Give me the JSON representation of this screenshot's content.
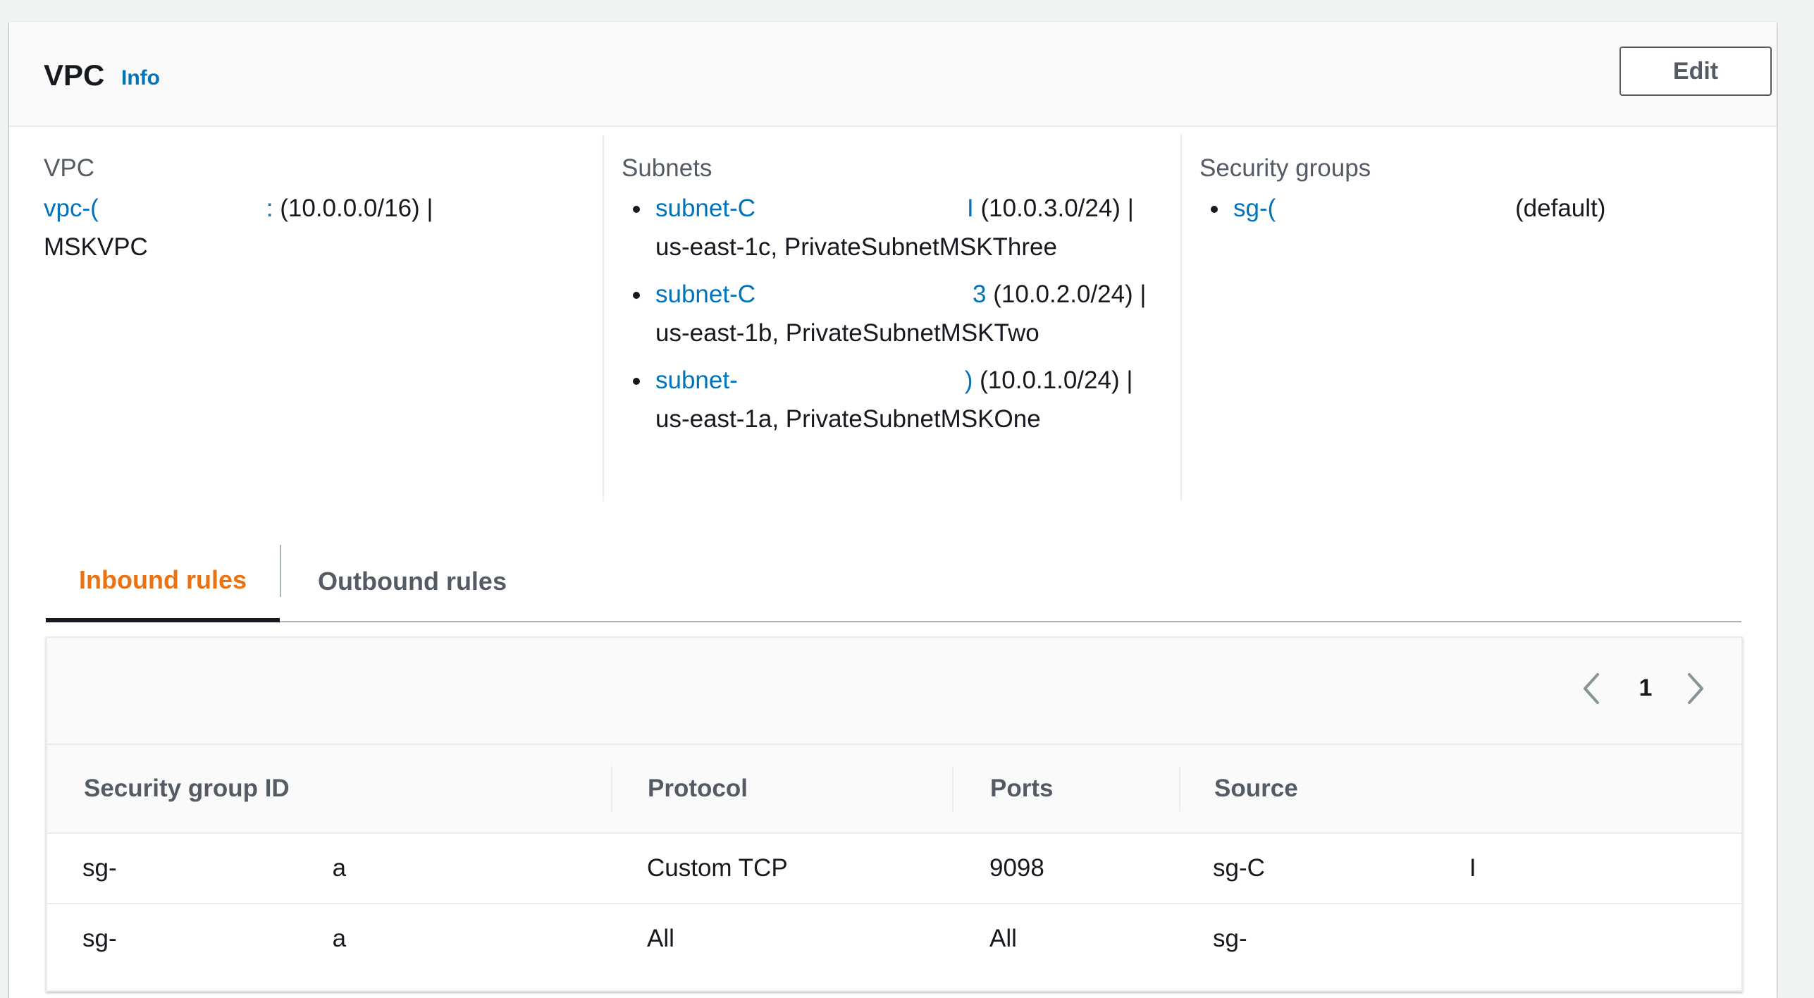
{
  "header": {
    "title": "VPC",
    "info_label": "Info",
    "edit_label": "Edit"
  },
  "vpc": {
    "label": "VPC",
    "id_link": "vpc-(",
    "id_tail": ": ",
    "cidr": "(10.0.0.0/16) |",
    "name": "MSKVPC"
  },
  "subnets": {
    "label": "Subnets",
    "items": [
      {
        "id": "subnet-C",
        "tail": "I",
        "cidr": "(10.0.3.0/24) |",
        "detail": "us-east-1c, PrivateSubnetMSKThree"
      },
      {
        "id": "subnet-C",
        "tail": "3",
        "cidr": "(10.0.2.0/24) |",
        "detail": "us-east-1b, PrivateSubnetMSKTwo"
      },
      {
        "id": "subnet-",
        "tail": ")",
        "cidr": "(10.0.1.0/24) |",
        "detail": "us-east-1a, PrivateSubnetMSKOne"
      }
    ]
  },
  "security_groups": {
    "label": "Security groups",
    "items": [
      {
        "id": "sg-(",
        "suffix": "(default)"
      }
    ]
  },
  "tabs": {
    "inbound": "Inbound rules",
    "outbound": "Outbound rules",
    "active": "inbound"
  },
  "pagination": {
    "page": "1",
    "prev_icon": "chevron-left-icon",
    "next_icon": "chevron-right-icon"
  },
  "table": {
    "columns": [
      "Security group ID",
      "Protocol",
      "Ports",
      "Source"
    ],
    "rows": [
      {
        "sg_id": "sg-",
        "sg_tail": "a",
        "protocol": "Custom TCP",
        "ports": "9098",
        "source": "sg-C",
        "source_tail": "I"
      },
      {
        "sg_id": "sg-",
        "sg_tail": "a",
        "protocol": "All",
        "ports": "All",
        "source": "sg-",
        "source_tail": ""
      }
    ]
  },
  "colors": {
    "link": "#0073bb",
    "active_tab": "#ec7211",
    "text": "#16191f",
    "muted": "#545b64"
  }
}
